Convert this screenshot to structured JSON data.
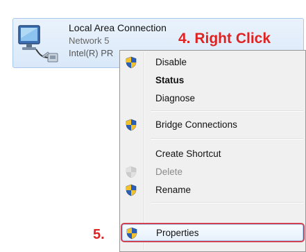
{
  "adapter": {
    "name": "Local Area Connection",
    "network": "Network  5",
    "device": "Intel(R) PR"
  },
  "annotations": {
    "step4": "4. Right Click",
    "step5": "5."
  },
  "context_menu": {
    "items": [
      {
        "label": "Disable",
        "icon": "shield-icon"
      },
      {
        "label": "Status",
        "icon": "",
        "bold": true
      },
      {
        "label": "Diagnose",
        "icon": ""
      },
      {
        "label": "Bridge Connections",
        "icon": "shield-icon"
      },
      {
        "label": "Create Shortcut",
        "icon": ""
      },
      {
        "label": "Delete",
        "icon": "shield-icon",
        "disabled": true
      },
      {
        "label": "Rename",
        "icon": "shield-icon"
      },
      {
        "label": "Properties",
        "icon": "shield-icon",
        "highlighted": true
      }
    ]
  },
  "colors": {
    "annotation": "#e02222",
    "shield_blue": "#2a5fb8",
    "shield_yellow": "#f2c12e",
    "highlight_box": "#d14250"
  }
}
